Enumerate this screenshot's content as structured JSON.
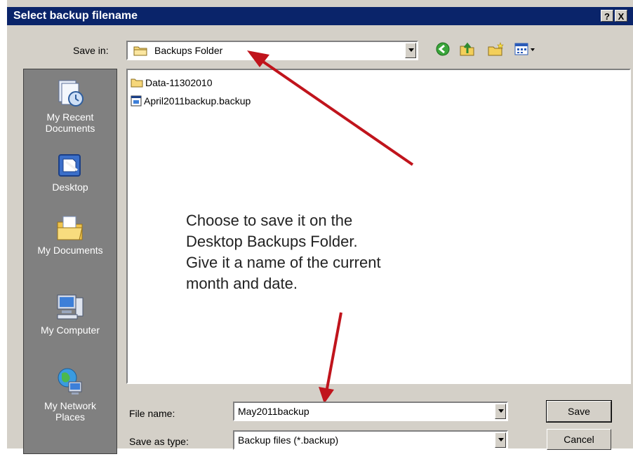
{
  "dialog": {
    "title": "Select backup filename",
    "help_button": "?",
    "close_button": "X"
  },
  "save_in": {
    "label": "Save in:",
    "value": "Backups Folder"
  },
  "toolbar": {
    "back_icon": "back-arrow-icon",
    "up_icon": "up-folder-icon",
    "new_folder_icon": "new-folder-icon",
    "views_icon": "views-menu-icon"
  },
  "places": [
    {
      "label_line1": "My Recent",
      "label_line2": "Documents",
      "icon": "recent-documents-icon"
    },
    {
      "label_line1": "Desktop",
      "label_line2": "",
      "icon": "desktop-icon"
    },
    {
      "label_line1": "My Documents",
      "label_line2": "",
      "icon": "my-documents-icon"
    },
    {
      "label_line1": "My Computer",
      "label_line2": "",
      "icon": "my-computer-icon"
    },
    {
      "label_line1": "My Network",
      "label_line2": "Places",
      "icon": "network-places-icon"
    }
  ],
  "files": [
    {
      "name": "Data-11302010",
      "type": "folder"
    },
    {
      "name": "April2011backup.backup",
      "type": "file"
    }
  ],
  "filename": {
    "label": "File name:",
    "value": "May2011backup"
  },
  "filetype": {
    "label": "Save as type:",
    "value": "Backup files (*.backup)"
  },
  "buttons": {
    "save": "Save",
    "cancel": "Cancel"
  },
  "annotation": {
    "line1": "Choose to save it on the",
    "line2": "Desktop Backups Folder.",
    "line3": "Give it a name of the current",
    "line4": "month and date."
  },
  "colors": {
    "titlebar": "#0a246a",
    "dialog_face": "#d4d0c8",
    "places_bar": "#808080",
    "arrow": "#c0141c"
  }
}
